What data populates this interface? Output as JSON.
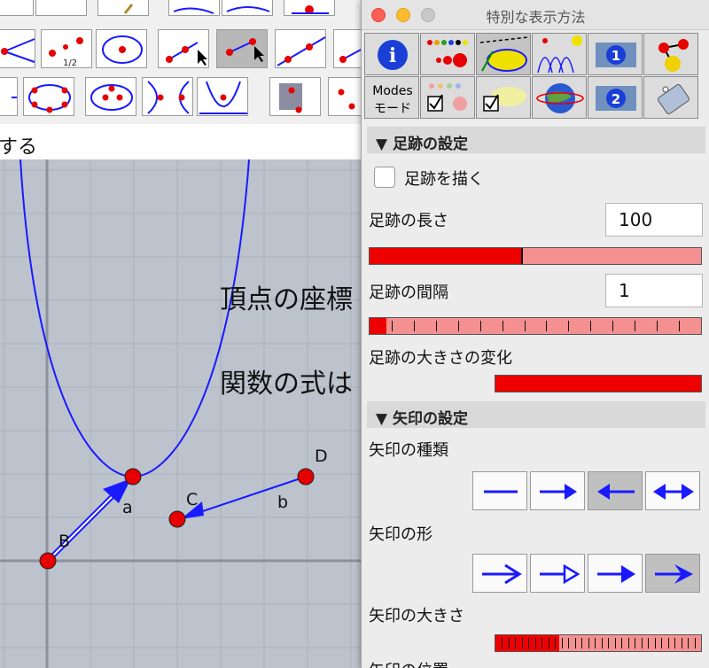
{
  "toolbar": {
    "row1": [
      "triangle-tool",
      "point-tool",
      "point-tool",
      "polygon-tool",
      "polygon-tool",
      "segment-tool",
      "curve-tool"
    ],
    "row2": [
      {
        "icon": "angle-tool-icon",
        "label": ""
      },
      {
        "icon": "midpoint-tool-icon",
        "label": "1/2"
      },
      {
        "icon": "circle-tool-icon",
        "label": ""
      },
      {
        "icon": "segment-tool-icon",
        "label": ""
      },
      {
        "icon": "segment-select-tool-icon",
        "label": ""
      },
      {
        "icon": "line-tool-icon",
        "label": ""
      },
      {
        "icon": "ray-tool-icon",
        "label": ""
      }
    ],
    "row3": [
      "arrow-tool-icon",
      "ellipse-tool-icon",
      "ellipse-points-tool-icon",
      "hyperbola-tool-icon",
      "parabola-tool-icon",
      "locus-tool-icon",
      "point-on-object-tool-icon"
    ]
  },
  "status_text": "する",
  "graph": {
    "text_vertex": "頂点の座標",
    "text_function": "関数の式は",
    "points": {
      "A_label": "a",
      "B_label": "B",
      "C_label": "C",
      "D_label": "D",
      "b_label": "b"
    }
  },
  "panel": {
    "title": "特別な表示方法",
    "tabs": [
      {
        "name": "info-tab",
        "icon": "info-icon"
      },
      {
        "name": "point-style-tab",
        "icon": "colored-dots-icon"
      },
      {
        "name": "line-style-tab",
        "icon": "ellipse-style-icon"
      },
      {
        "name": "trace-tab",
        "icon": "trace-arcs-icon"
      },
      {
        "name": "layer1-tab",
        "icon": "layer-1-icon"
      },
      {
        "name": "objects-tab",
        "icon": "molecule-icon"
      },
      {
        "name": "modes-tab",
        "icon": "modes-icon",
        "label_top": "Modes",
        "label_bottom": "モード"
      },
      {
        "name": "visibility-tab",
        "icon": "checkbox-dots-icon"
      },
      {
        "name": "fill-tab",
        "icon": "checkbox-ellipse-icon"
      },
      {
        "name": "globe-tab",
        "icon": "globe-icon"
      },
      {
        "name": "layer2-tab",
        "icon": "layer-2-icon"
      },
      {
        "name": "tag-tab",
        "icon": "tag-icon"
      }
    ],
    "trace_section": {
      "header": "▼ 足跡の設定",
      "draw_trace_label": "足跡を描く",
      "draw_trace_checked": false,
      "length_label": "足跡の長さ",
      "length_value": "100",
      "length_fraction": 0.46,
      "interval_label": "足跡の間隔",
      "interval_value": "1",
      "interval_fraction": 0.05,
      "size_change_label": "足跡の大きさの変化",
      "size_change_fraction": 1.0
    },
    "arrow_section": {
      "header": "▼ 矢印の設定",
      "type_label": "矢印の種類",
      "type_options": [
        "line-icon",
        "arrow-right-icon",
        "arrow-left-icon",
        "arrow-both-icon"
      ],
      "type_selected": 2,
      "shape_label": "矢印の形",
      "shape_options": [
        "open-arrow-icon",
        "hollow-arrow-icon",
        "filled-arrow-icon",
        "barbed-arrow-icon"
      ],
      "shape_selected": 3,
      "size_label": "矢印の大きさ",
      "size_fraction": 0.31,
      "position_label": "矢印の位置"
    }
  },
  "colors": {
    "accent_red": "#ef0000",
    "slider_bg": "#f49090",
    "curve_blue": "#1a1aff",
    "point_red": "#e60000",
    "graph_bg": "#bcc3cd"
  }
}
